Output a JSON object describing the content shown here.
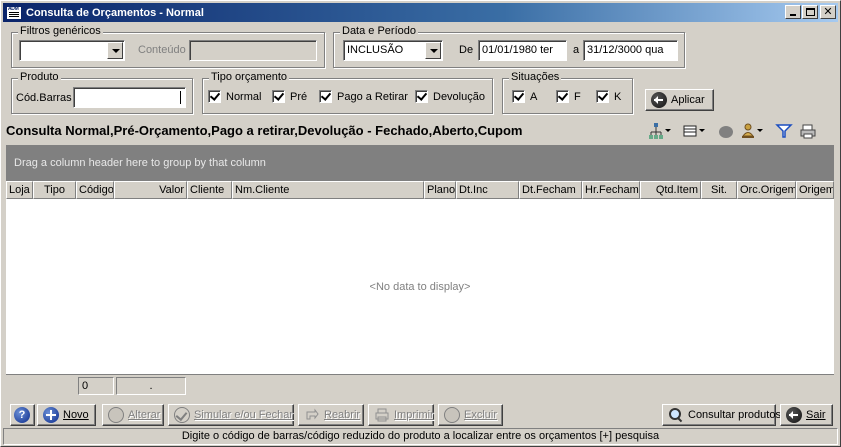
{
  "window": {
    "title": "Consulta de Orçamentos - Normal",
    "app_icon_text": "ADM"
  },
  "filtros": {
    "legend": "Filtros genéricos",
    "combo_value": "",
    "conteudo_label": "Conteúdo",
    "conteudo_value": ""
  },
  "periodo": {
    "legend": "Data e Período",
    "combo_value": "INCLUSÃO",
    "de_label": "De",
    "de_value": "01/01/1980 ter",
    "a_label": "a",
    "a_value": "31/12/3000 qua"
  },
  "produto": {
    "legend": "Produto",
    "cod_barras_label": "Cód.Barras",
    "cod_barras_value": ""
  },
  "tipo_orcamento": {
    "legend": "Tipo orçamento",
    "items": [
      {
        "label": "Normal",
        "checked": true
      },
      {
        "label": "Pré",
        "checked": true
      },
      {
        "label": "Pago a Retirar",
        "checked": true
      },
      {
        "label": "Devolução",
        "checked": true
      }
    ]
  },
  "situacoes": {
    "legend": "Situações",
    "items": [
      {
        "label": "A",
        "checked": true
      },
      {
        "label": "F",
        "checked": true
      },
      {
        "label": "K",
        "checked": true
      }
    ]
  },
  "aplicar_label": "Aplicar",
  "heading": "Consulta Normal,Pré-Orçamento,Pago a retirar,Devolução - Fechado,Aberto,Cupom",
  "toolbar_icons": [
    "tree-icon",
    "grid-layout-icon",
    "oval-icon",
    "bell-icon",
    "filter-icon",
    "print-icon"
  ],
  "grid": {
    "group_hint": "Drag a column header here to group by that column",
    "columns": [
      "Loja",
      "Tipo",
      "Código",
      "Valor",
      "Cliente",
      "Nm.Cliente",
      "Plano",
      "Dt.Inc",
      "Dt.Fecham",
      "Hr.Fecham",
      "Qtd.Item",
      "Sit.",
      "Orc.Origem",
      "Origem"
    ],
    "empty_text": "<No data to display>",
    "footer_count": "0",
    "footer_sum": "."
  },
  "buttons": {
    "help": "?",
    "novo": "Novo",
    "alterar": "Alterar",
    "simular": "Simular e/ou Fechar",
    "reabrir": "Reabrir",
    "imprimir": "Imprimir",
    "excluir": "Excluir",
    "consultar": "Consultar produtos",
    "sair": "Sair"
  },
  "status": "Digite o código de barras/código reduzido do produto a localizar entre os orçamentos [+] pesquisa"
}
